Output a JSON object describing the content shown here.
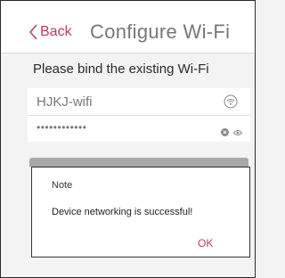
{
  "header": {
    "back_label": "Back",
    "title": "Configure Wi-Fi"
  },
  "subtitle": "Please bind the existing Wi-Fi",
  "form": {
    "ssid_value": "HJKJ-wifi",
    "password_value": "••••••••••••"
  },
  "dialog": {
    "title": "Note",
    "message": "Device networking is successful!",
    "ok_label": "OK"
  },
  "colors": {
    "accent": "#c23a5b",
    "background": "#f3f3f3",
    "dim_bar": "#a8a8a8"
  },
  "icons": {
    "back": "chevron-left-icon",
    "wifi": "wifi-icon",
    "clear": "clear-icon",
    "visibility": "eye-icon"
  }
}
